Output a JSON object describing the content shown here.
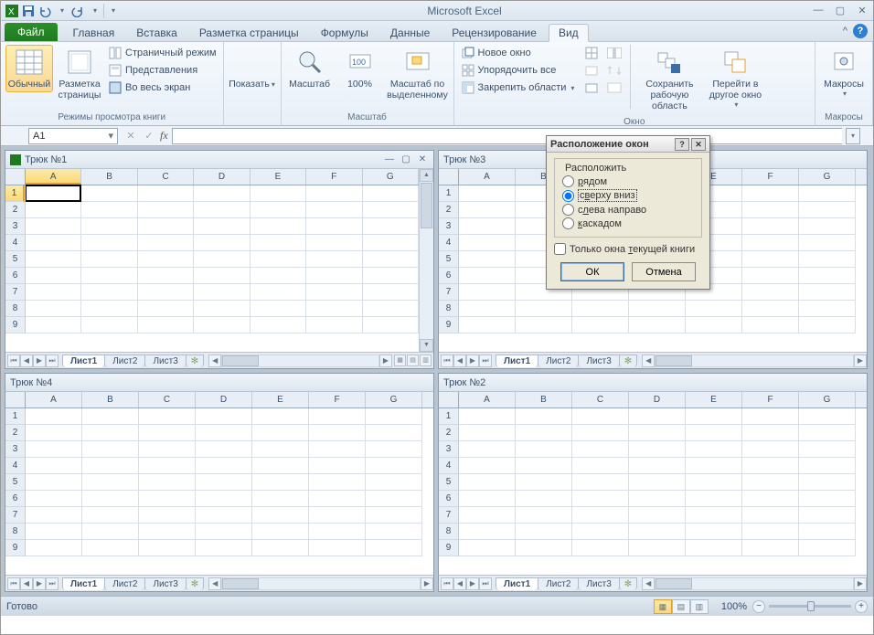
{
  "app": {
    "title": "Microsoft Excel"
  },
  "qat": {
    "save": "save",
    "undo": "undo",
    "redo": "redo"
  },
  "tabs": {
    "file": "Файл",
    "items": [
      "Главная",
      "Вставка",
      "Разметка страницы",
      "Формулы",
      "Данные",
      "Рецензирование",
      "Вид"
    ],
    "active": "Вид"
  },
  "ribbon": {
    "g1": {
      "label": "Режимы просмотра книги",
      "normal": "Обычный",
      "layout": "Разметка\nстраницы",
      "pagebreak": "Страничный режим",
      "views": "Представления",
      "fullscreen": "Во весь экран"
    },
    "g2": {
      "label": "",
      "show": "Показать"
    },
    "g3": {
      "label": "Масштаб",
      "zoom": "Масштаб",
      "hundred": "100%",
      "tosel": "Масштаб по\nвыделенному"
    },
    "g4": {
      "label": "Окно",
      "neww": "Новое окно",
      "arrange": "Упорядочить все",
      "freeze": "Закрепить области",
      "save_ws": "Сохранить\nрабочую область",
      "switch": "Перейти в\nдругое окно"
    },
    "g5": {
      "label": "Макросы",
      "macros": "Макросы"
    }
  },
  "fbar": {
    "cell": "A1",
    "fx": "fx"
  },
  "workbooks": {
    "w1": {
      "title": "Трюк №1",
      "sheets": [
        "Лист1",
        "Лист2",
        "Лист3"
      ],
      "cols": [
        "A",
        "B",
        "C",
        "D",
        "E",
        "F",
        "G"
      ],
      "rows": 9,
      "active": true
    },
    "w3": {
      "title": "Трюк №3",
      "sheets": [
        "Лист1",
        "Лист2",
        "Лист3"
      ],
      "cols": [
        "A",
        "B",
        "C",
        "D",
        "E",
        "F",
        "G"
      ],
      "rows": 9
    },
    "w4": {
      "title": "Трюк №4",
      "sheets": [
        "Лист1",
        "Лист2",
        "Лист3"
      ],
      "cols": [
        "A",
        "B",
        "C",
        "D",
        "E",
        "F",
        "G"
      ],
      "rows": 9
    },
    "w2": {
      "title": "Трюк №2",
      "sheets": [
        "Лист1",
        "Лист2",
        "Лист3"
      ],
      "cols": [
        "A",
        "B",
        "C",
        "D",
        "E",
        "F",
        "G"
      ],
      "rows": 9
    }
  },
  "dialog": {
    "title": "Расположение окон",
    "group": "Расположить",
    "opt_tiled": "рядом",
    "opt_horiz": "сверху вниз",
    "opt_vert": "слева направо",
    "opt_cascade": "каскадом",
    "selected": "opt_horiz",
    "chk": "Только окна текущей книги",
    "ok": "ОК",
    "cancel": "Отмена"
  },
  "status": {
    "ready": "Готово",
    "zoom": "100%"
  }
}
